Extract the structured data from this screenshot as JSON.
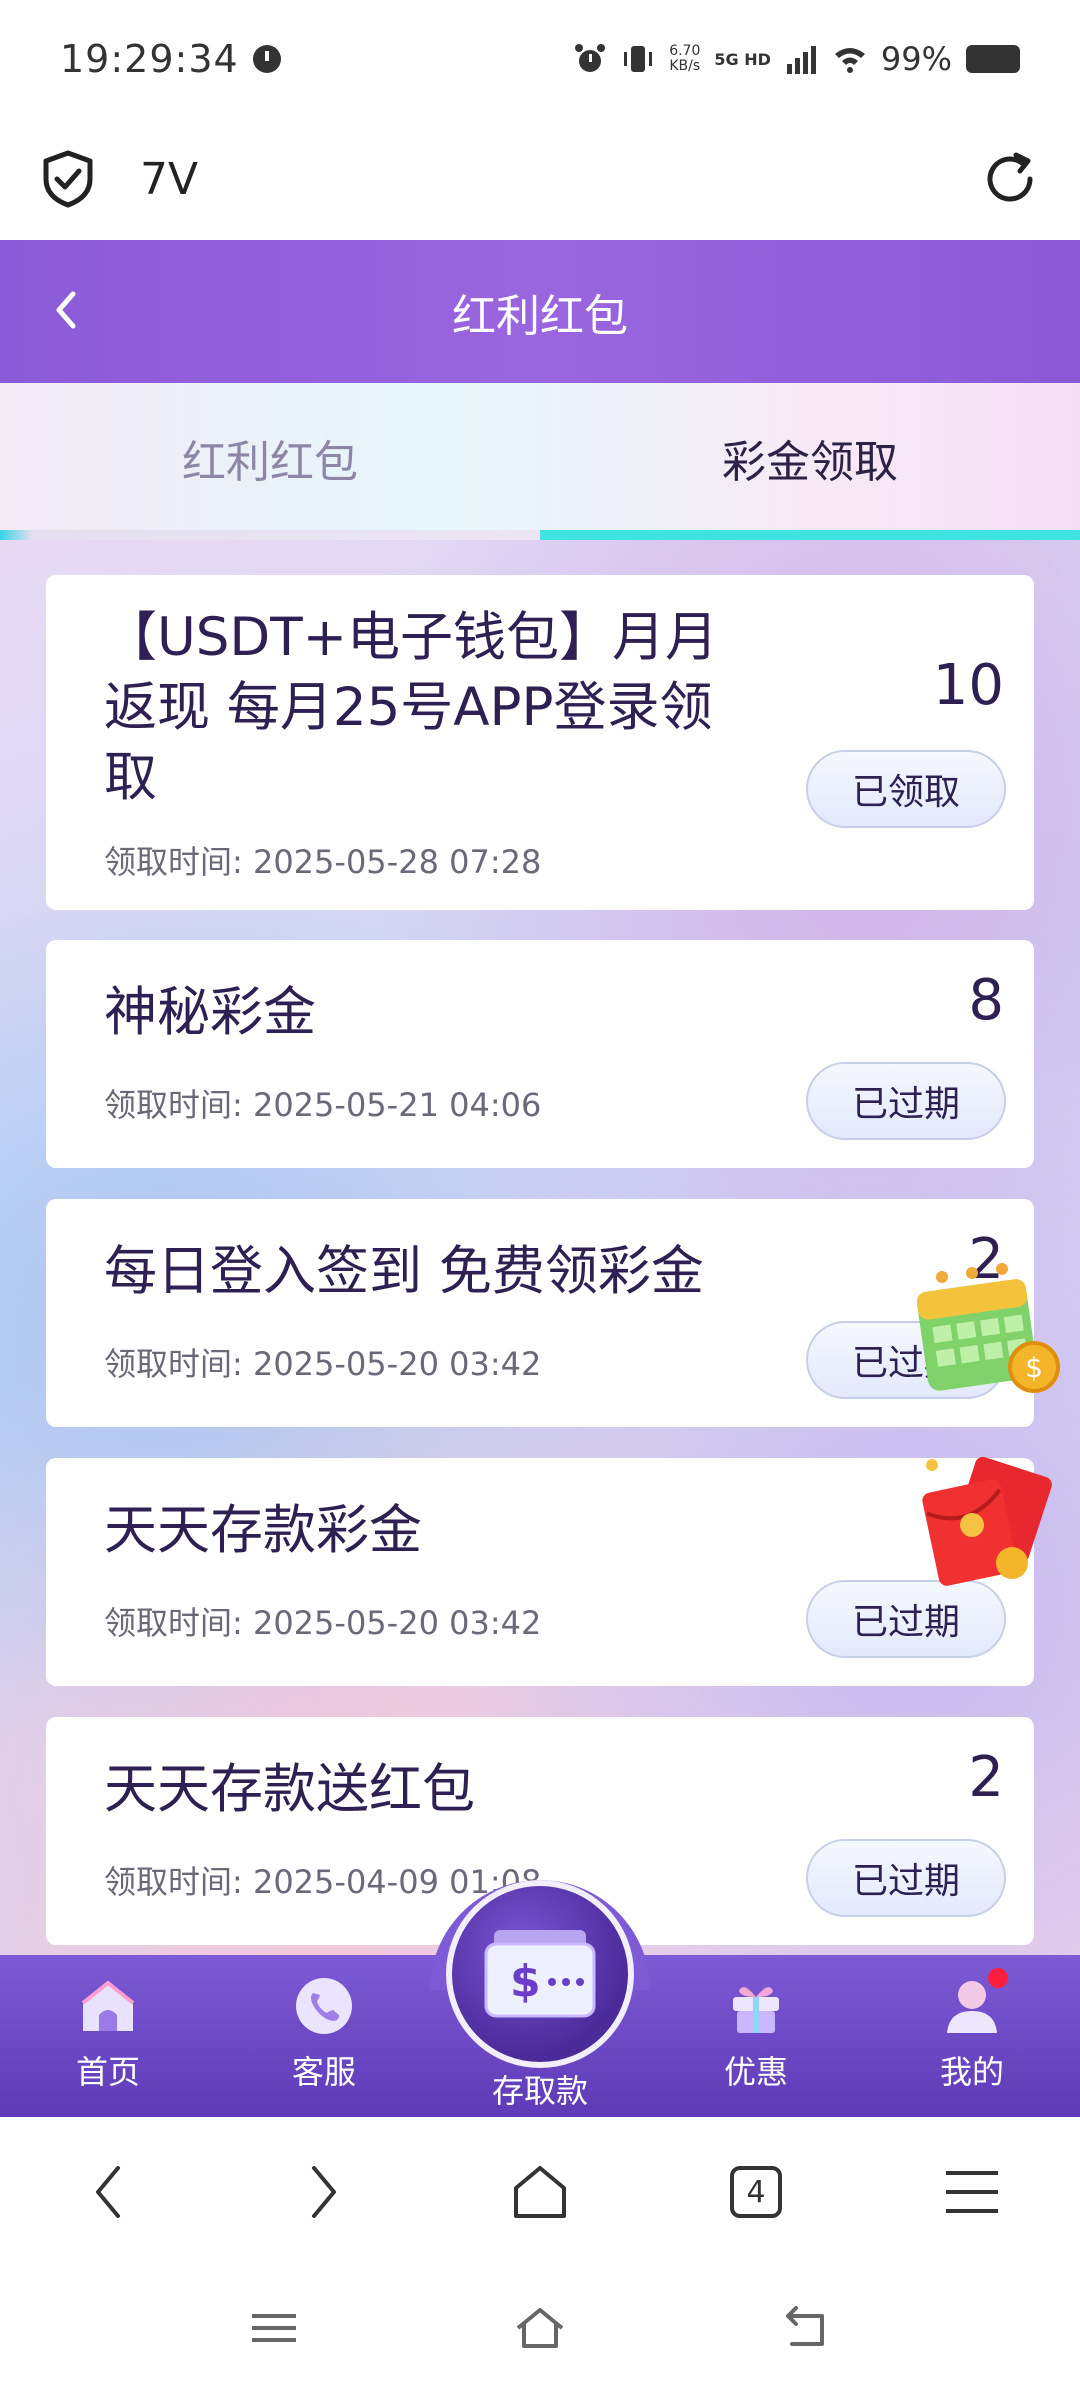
{
  "status_bar": {
    "time": "19:29:34",
    "net_speed_value": "6.70",
    "net_speed_unit": "KB/s",
    "network": "5G HD",
    "battery_pct": "99%"
  },
  "browser": {
    "site_title": "7V",
    "tab_count": "4"
  },
  "header": {
    "title": "红利红包"
  },
  "tabs": [
    {
      "label": "红利红包",
      "active": false
    },
    {
      "label": "彩金领取",
      "active": true
    }
  ],
  "time_prefix": "领取时间: ",
  "cards": [
    {
      "title_l1": "【USDT+电子钱包】月月",
      "title_l2": "返现 每月25号APP登录领",
      "title_l3": "取",
      "time": "领取时间: 2025-05-28 07:28",
      "amount": "10",
      "status": "已领取"
    },
    {
      "title_l1": "神秘彩金",
      "time": "领取时间: 2025-05-21 04:06",
      "amount": "8",
      "status": "已过期"
    },
    {
      "title_l1": "每日登入签到 免费领彩金",
      "time": "领取时间: 2025-05-20 03:42",
      "amount": "2",
      "status": "已过期"
    },
    {
      "title_l1": "天天存款彩金",
      "time": "领取时间: 2025-05-20 03:42",
      "amount": "",
      "status": "已过期"
    },
    {
      "title_l1": "天天存款送红包",
      "time": "领取时间: 2025-04-09 01:08",
      "amount": "2",
      "status": "已过期"
    }
  ],
  "bottom_nav": {
    "home": "首页",
    "service": "客服",
    "deposit": "存取款",
    "promo": "优惠",
    "mine": "我的"
  },
  "colors": {
    "header_purple": "#8a5bd8",
    "nav_purple": "#6a45c4",
    "tab_indicator": "#3fe4e0",
    "badge_red": "#ff1f3d"
  }
}
